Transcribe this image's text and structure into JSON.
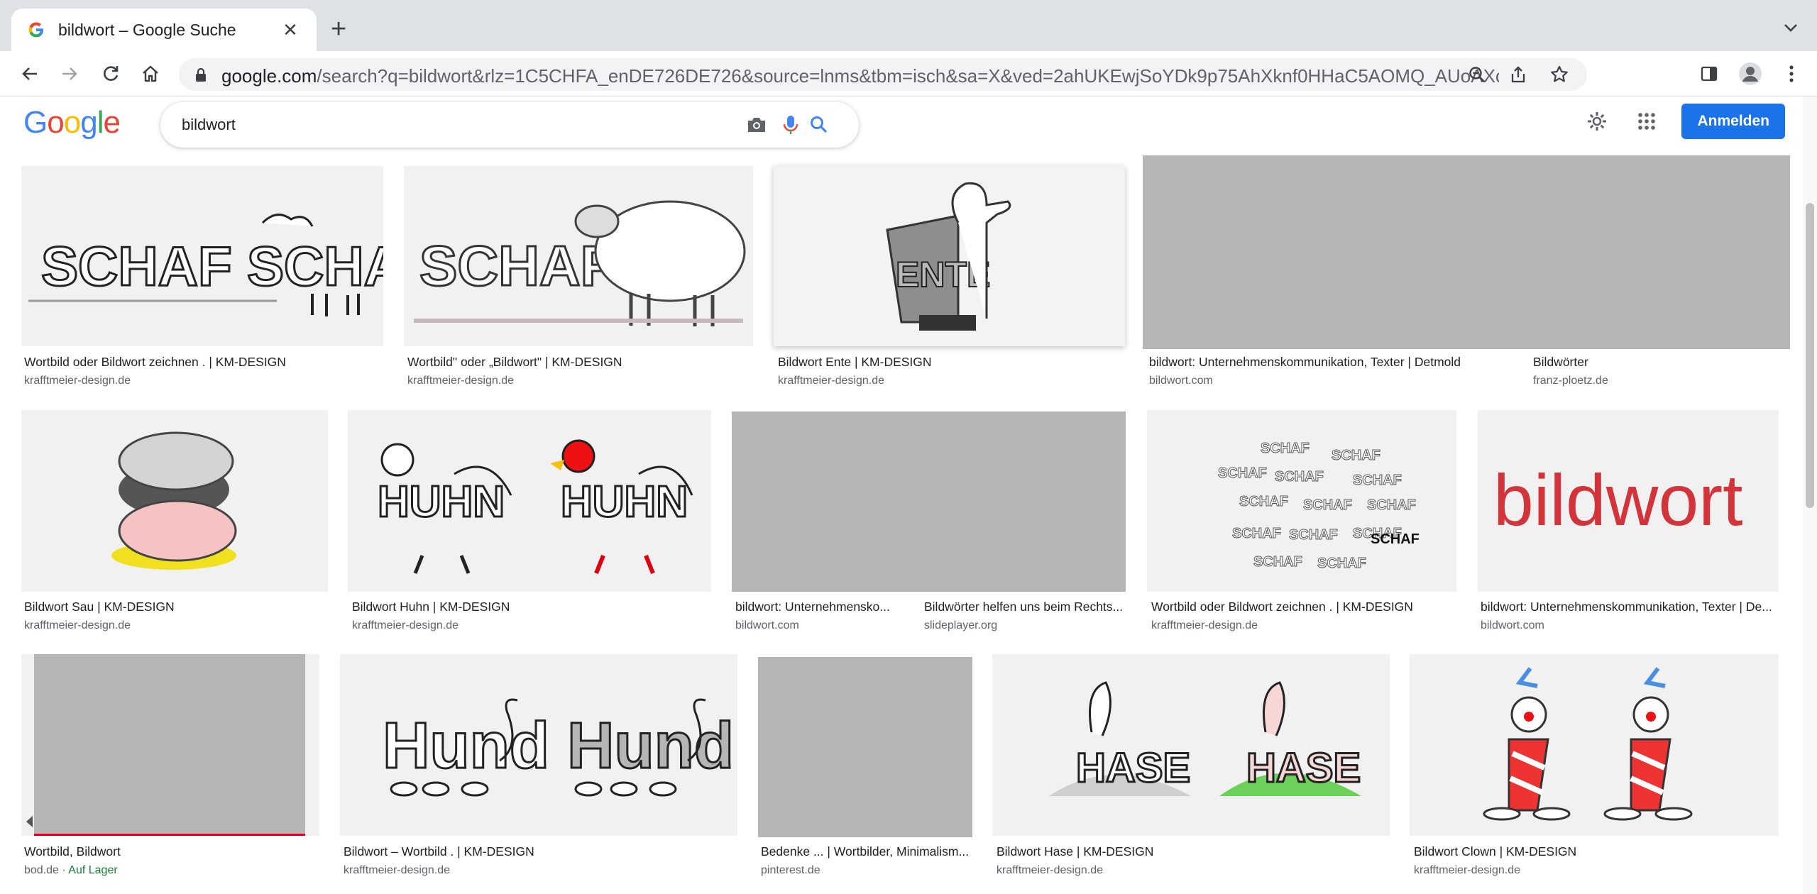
{
  "browser": {
    "tab_title": "bildwort – Google Suche",
    "url_host": "google.com",
    "url_rest": "/search?q=bildwort&rlz=1C5CHFA_enDE726DE726&source=lnms&tbm=isch&sa=X&ved=2ahUKEwjSoYDk9p75AhXknf0HHaC5AOMQ_AUoAXoEC..."
  },
  "search": {
    "query": "bildwort"
  },
  "header": {
    "signin_label": "Anmelden"
  },
  "results": [
    {
      "caption": "Wortbild oder Bildwort zeichnen . | KM-DESIGN",
      "source": "krafftmeier-design.de"
    },
    {
      "caption": "Wortbild\" oder „Bildwort\" | KM-DESIGN",
      "source": "krafftmeier-design.de"
    },
    {
      "caption": "Bildwort Ente | KM-DESIGN",
      "source": "krafftmeier-design.de"
    },
    {
      "caption": "bildwort: Unternehmenskommunikation, Texter | Detmold",
      "source": "bildwort.com"
    },
    {
      "caption": "Bildwörter",
      "source": "franz-ploetz.de"
    },
    {
      "caption": "Bildwort Sau | KM-DESIGN",
      "source": "krafftmeier-design.de"
    },
    {
      "caption": "Bildwort Huhn | KM-DESIGN",
      "source": "krafftmeier-design.de"
    },
    {
      "caption": "bildwort: Unternehmensko...",
      "source": "bildwort.com"
    },
    {
      "caption": "Bildwörter helfen uns beim Rechts...",
      "source": "slideplayer.org"
    },
    {
      "caption": "Wortbild oder Bildwort zeichnen . | KM-DESIGN",
      "source": "krafftmeier-design.de"
    },
    {
      "caption": "bildwort: Unternehmenskommunikation, Texter | De...",
      "source": "bildwort.com"
    },
    {
      "caption": "Wortbild, Bildwort",
      "source": "bod.de",
      "stock": "Auf Lager"
    },
    {
      "caption": "Bildwort – Wortbild . | KM-DESIGN",
      "source": "krafftmeier-design.de"
    },
    {
      "caption": "Bedenke ... | Wortbilder, Minimalism...",
      "source": "pinterest.de"
    },
    {
      "caption": "Bildwort Hase | KM-DESIGN",
      "source": "krafftmeier-design.de"
    },
    {
      "caption": "Bildwort Clown | KM-DESIGN",
      "source": "krafftmeier-design.de"
    }
  ],
  "image_text": {
    "schaf": "SCHAF",
    "ente": "ENTE",
    "huhn": "HUHN",
    "hund": "Hund",
    "hase": "HASE",
    "bildwort_logo": "bildwort"
  },
  "colors": {
    "google_blue": "#4285F4",
    "google_red": "#EA4335",
    "google_yellow": "#FBBC05",
    "google_green": "#34A853",
    "signin_button": "#1a73e8",
    "placeholder_gray": "#b6b6b6",
    "stock_green": "#188038",
    "bildwort_red": "#d2343a"
  }
}
